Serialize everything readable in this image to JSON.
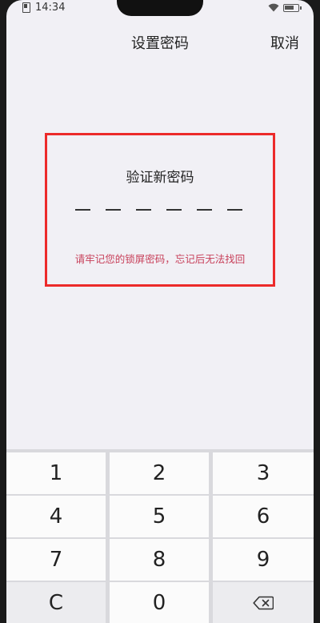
{
  "status_bar": {
    "time": "14:34",
    "battery_level": 0.8
  },
  "nav": {
    "title": "设置密码",
    "cancel_label": "取消"
  },
  "pin_panel": {
    "heading": "验证新密码",
    "slot_count": 6,
    "warning": "请牢记您的锁屏密码，忘记后无法找回",
    "highlight_color": "#ec2a2a"
  },
  "keypad": {
    "keys": [
      "1",
      "2",
      "3",
      "4",
      "5",
      "6",
      "7",
      "8",
      "9"
    ],
    "clear_label": "C",
    "zero_label": "0",
    "backspace_icon": "backspace-icon"
  }
}
